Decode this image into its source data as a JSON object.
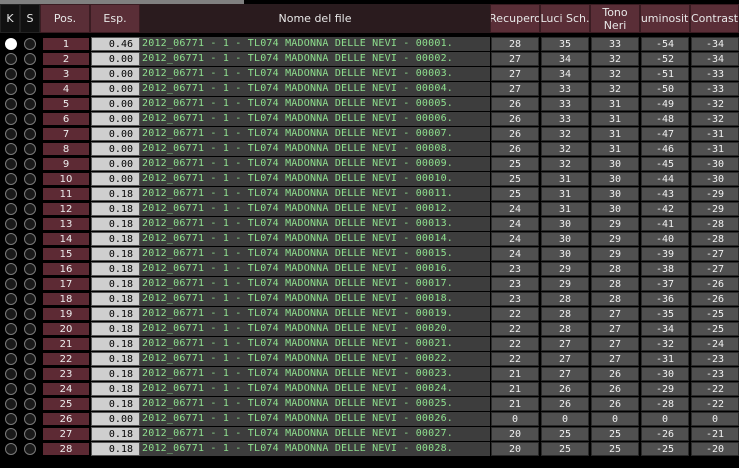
{
  "header": {
    "k": "K",
    "s": "S",
    "pos": "Pos.",
    "esp": "Esp.",
    "nome": "Nome del file",
    "recupero": "Recupero",
    "luci": "Luci Sch.",
    "tono": "Tono\nNeri",
    "luminosita": "Luminosità",
    "contrasto": "Contrasto"
  },
  "colors": {
    "pos_bg": "#5d2a34",
    "filename_text": "#8ee08e",
    "value_bg": "#505050"
  },
  "rows": [
    {
      "pos": "1",
      "esp": "0.46",
      "file": "2012_06771 - 1 - TL074 MADONNA DELLE NEVI - 00001.",
      "rec": "28",
      "luci": "35",
      "tono": "33",
      "lum": "-54",
      "con": "-34",
      "k": true
    },
    {
      "pos": "2",
      "esp": "0.00",
      "file": "2012_06771 - 1 - TL074 MADONNA DELLE NEVI - 00002.",
      "rec": "27",
      "luci": "34",
      "tono": "32",
      "lum": "-52",
      "con": "-34",
      "k": false
    },
    {
      "pos": "3",
      "esp": "0.00",
      "file": "2012_06771 - 1 - TL074 MADONNA DELLE NEVI - 00003.",
      "rec": "27",
      "luci": "34",
      "tono": "32",
      "lum": "-51",
      "con": "-33",
      "k": false
    },
    {
      "pos": "4",
      "esp": "0.00",
      "file": "2012_06771 - 1 - TL074 MADONNA DELLE NEVI - 00004.",
      "rec": "27",
      "luci": "33",
      "tono": "32",
      "lum": "-50",
      "con": "-33",
      "k": false
    },
    {
      "pos": "5",
      "esp": "0.00",
      "file": "2012_06771 - 1 - TL074 MADONNA DELLE NEVI - 00005.",
      "rec": "26",
      "luci": "33",
      "tono": "31",
      "lum": "-49",
      "con": "-32",
      "k": false
    },
    {
      "pos": "6",
      "esp": "0.00",
      "file": "2012_06771 - 1 - TL074 MADONNA DELLE NEVI - 00006.",
      "rec": "26",
      "luci": "33",
      "tono": "31",
      "lum": "-48",
      "con": "-32",
      "k": false
    },
    {
      "pos": "7",
      "esp": "0.00",
      "file": "2012_06771 - 1 - TL074 MADONNA DELLE NEVI - 00007.",
      "rec": "26",
      "luci": "32",
      "tono": "31",
      "lum": "-47",
      "con": "-31",
      "k": false
    },
    {
      "pos": "8",
      "esp": "0.00",
      "file": "2012_06771 - 1 - TL074 MADONNA DELLE NEVI - 00008.",
      "rec": "26",
      "luci": "32",
      "tono": "31",
      "lum": "-46",
      "con": "-31",
      "k": false
    },
    {
      "pos": "9",
      "esp": "0.00",
      "file": "2012_06771 - 1 - TL074 MADONNA DELLE NEVI - 00009.",
      "rec": "25",
      "luci": "32",
      "tono": "30",
      "lum": "-45",
      "con": "-30",
      "k": false
    },
    {
      "pos": "10",
      "esp": "0.00",
      "file": "2012_06771 - 1 - TL074 MADONNA DELLE NEVI - 00010.",
      "rec": "25",
      "luci": "31",
      "tono": "30",
      "lum": "-44",
      "con": "-30",
      "k": false
    },
    {
      "pos": "11",
      "esp": "0.18",
      "file": "2012_06771 - 1 - TL074 MADONNA DELLE NEVI - 00011.",
      "rec": "25",
      "luci": "31",
      "tono": "30",
      "lum": "-43",
      "con": "-29",
      "k": false
    },
    {
      "pos": "12",
      "esp": "0.18",
      "file": "2012_06771 - 1 - TL074 MADONNA DELLE NEVI - 00012.",
      "rec": "24",
      "luci": "31",
      "tono": "30",
      "lum": "-42",
      "con": "-29",
      "k": false
    },
    {
      "pos": "13",
      "esp": "0.18",
      "file": "2012_06771 - 1 - TL074 MADONNA DELLE NEVI - 00013.",
      "rec": "24",
      "luci": "30",
      "tono": "29",
      "lum": "-41",
      "con": "-28",
      "k": false
    },
    {
      "pos": "14",
      "esp": "0.18",
      "file": "2012_06771 - 1 - TL074 MADONNA DELLE NEVI - 00014.",
      "rec": "24",
      "luci": "30",
      "tono": "29",
      "lum": "-40",
      "con": "-28",
      "k": false
    },
    {
      "pos": "15",
      "esp": "0.18",
      "file": "2012_06771 - 1 - TL074 MADONNA DELLE NEVI - 00015.",
      "rec": "24",
      "luci": "30",
      "tono": "29",
      "lum": "-39",
      "con": "-27",
      "k": false
    },
    {
      "pos": "16",
      "esp": "0.18",
      "file": "2012_06771 - 1 - TL074 MADONNA DELLE NEVI - 00016.",
      "rec": "23",
      "luci": "29",
      "tono": "28",
      "lum": "-38",
      "con": "-27",
      "k": false
    },
    {
      "pos": "17",
      "esp": "0.18",
      "file": "2012_06771 - 1 - TL074 MADONNA DELLE NEVI - 00017.",
      "rec": "23",
      "luci": "29",
      "tono": "28",
      "lum": "-37",
      "con": "-26",
      "k": false
    },
    {
      "pos": "18",
      "esp": "0.18",
      "file": "2012_06771 - 1 - TL074 MADONNA DELLE NEVI - 00018.",
      "rec": "23",
      "luci": "28",
      "tono": "28",
      "lum": "-36",
      "con": "-26",
      "k": false
    },
    {
      "pos": "19",
      "esp": "0.18",
      "file": "2012_06771 - 1 - TL074 MADONNA DELLE NEVI - 00019.",
      "rec": "22",
      "luci": "28",
      "tono": "27",
      "lum": "-35",
      "con": "-25",
      "k": false
    },
    {
      "pos": "20",
      "esp": "0.18",
      "file": "2012_06771 - 1 - TL074 MADONNA DELLE NEVI - 00020.",
      "rec": "22",
      "luci": "28",
      "tono": "27",
      "lum": "-34",
      "con": "-25",
      "k": false
    },
    {
      "pos": "21",
      "esp": "0.18",
      "file": "2012_06771 - 1 - TL074 MADONNA DELLE NEVI - 00021.",
      "rec": "22",
      "luci": "27",
      "tono": "27",
      "lum": "-32",
      "con": "-24",
      "k": false
    },
    {
      "pos": "22",
      "esp": "0.18",
      "file": "2012_06771 - 1 - TL074 MADONNA DELLE NEVI - 00022.",
      "rec": "22",
      "luci": "27",
      "tono": "27",
      "lum": "-31",
      "con": "-23",
      "k": false
    },
    {
      "pos": "23",
      "esp": "0.18",
      "file": "2012_06771 - 1 - TL074 MADONNA DELLE NEVI - 00023.",
      "rec": "21",
      "luci": "27",
      "tono": "26",
      "lum": "-30",
      "con": "-23",
      "k": false
    },
    {
      "pos": "24",
      "esp": "0.18",
      "file": "2012_06771 - 1 - TL074 MADONNA DELLE NEVI - 00024.",
      "rec": "21",
      "luci": "26",
      "tono": "26",
      "lum": "-29",
      "con": "-22",
      "k": false
    },
    {
      "pos": "25",
      "esp": "0.18",
      "file": "2012_06771 - 1 - TL074 MADONNA DELLE NEVI - 00025.",
      "rec": "21",
      "luci": "26",
      "tono": "26",
      "lum": "-28",
      "con": "-22",
      "k": false
    },
    {
      "pos": "26",
      "esp": "0.00",
      "file": "2012_06771 - 1 - TL074 MADONNA DELLE NEVI - 00026.",
      "rec": "0",
      "luci": "0",
      "tono": "0",
      "lum": "0",
      "con": "0",
      "k": false
    },
    {
      "pos": "27",
      "esp": "0.18",
      "file": "2012_06771 - 1 - TL074 MADONNA DELLE NEVI - 00027.",
      "rec": "20",
      "luci": "25",
      "tono": "25",
      "lum": "-26",
      "con": "-21",
      "k": false
    },
    {
      "pos": "28",
      "esp": "0.18",
      "file": "2012_06771 - 1 - TL074 MADONNA DELLE NEVI - 00028.",
      "rec": "20",
      "luci": "25",
      "tono": "25",
      "lum": "-25",
      "con": "-20",
      "k": false
    }
  ]
}
